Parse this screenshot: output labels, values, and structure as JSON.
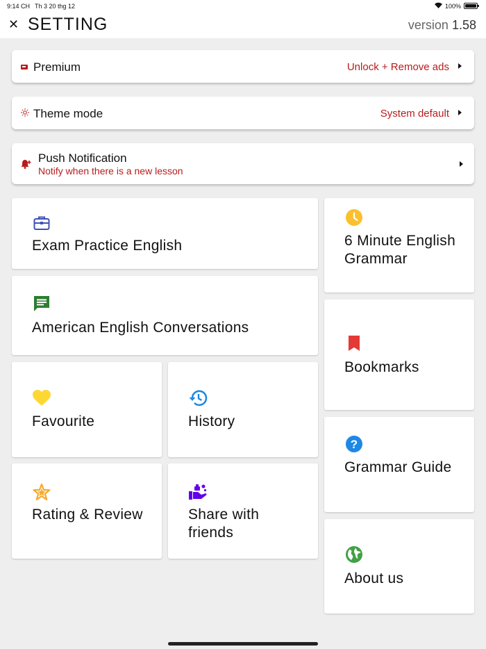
{
  "status_bar": {
    "time": "9:14 CH",
    "date": "Th 3 20 thg 12",
    "battery": "100%"
  },
  "header": {
    "title": "SETTING",
    "version_label": "version",
    "version_number": "1.58"
  },
  "settings": {
    "premium": {
      "label": "Premium",
      "value": "Unlock + Remove ads"
    },
    "theme": {
      "label": "Theme mode",
      "value": "System default"
    },
    "notification": {
      "label": "Push Notification",
      "subtitle": "Notify when there is a new lesson"
    }
  },
  "cards": {
    "exam": {
      "label": "Exam Practice English",
      "icon": "briefcase-icon",
      "color": "#3f51b5"
    },
    "conversations": {
      "label": "American English Conversations",
      "icon": "chat-icon",
      "color": "#2e7d32"
    },
    "favourite": {
      "label": "Favourite",
      "icon": "heart-icon",
      "color": "#fdd835"
    },
    "history": {
      "label": "History",
      "icon": "history-icon",
      "color": "#1e88e5"
    },
    "rating": {
      "label": "Rating & Review",
      "icon": "star-icon",
      "color": "#f9a825"
    },
    "share": {
      "label": "Share with friends",
      "icon": "share-hand-icon",
      "color": "#6200ea"
    },
    "six_minute": {
      "label": "6 Minute English Grammar",
      "icon": "clock-icon",
      "color": "#fbc02d"
    },
    "bookmarks": {
      "label": "Bookmarks",
      "icon": "bookmark-icon",
      "color": "#e53935"
    },
    "grammar_guide": {
      "label": "Grammar Guide",
      "icon": "question-icon",
      "color": "#1e88e5"
    },
    "about": {
      "label": "About us",
      "icon": "globe-icon",
      "color": "#43a047"
    }
  },
  "colors": {
    "accent_red": "#b71c1c",
    "background": "#eeeeee"
  }
}
